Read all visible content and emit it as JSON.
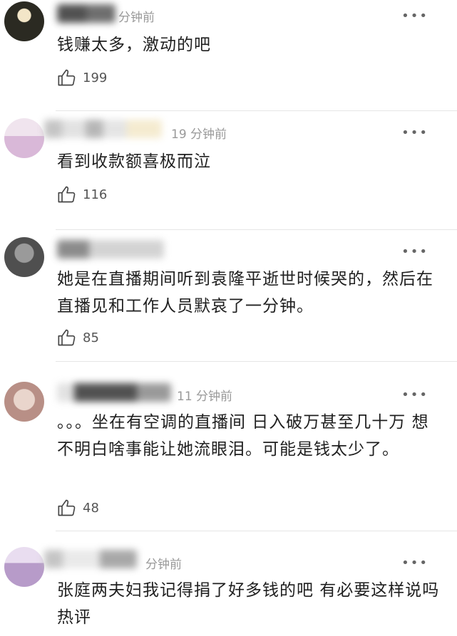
{
  "comments": [
    {
      "time": "分钟前",
      "text": "钱赚太多，激动的吧",
      "likes": "199",
      "more": "•••"
    },
    {
      "time": "19 分钟前",
      "text": "看到收款额喜极而泣",
      "likes": "116",
      "more": "•••"
    },
    {
      "time": "",
      "text": "她是在直播期间听到袁隆平逝世时候哭的，然后在直播见和工作人员默哀了一分钟。",
      "likes": "85",
      "more": "•••"
    },
    {
      "time": "11 分钟前",
      "text": "。。。坐在有空调的直播间 日入破万甚至几十万 想不明白啥事能让她流眼泪。可能是钱太少了。",
      "likes": "48",
      "more": "•••"
    },
    {
      "time": "分钟前",
      "text": "张庭两夫妇我记得捐了好多钱的吧 有必要这样说吗热评",
      "likes": "",
      "more": "•••"
    }
  ],
  "colors": {
    "avatar_1": "#3a3a2e",
    "avatar_2": "#d9b8d8",
    "avatar_3": "#6d6d6d",
    "avatar_4": "#c9a8a0",
    "avatar_5": "#b79bc9"
  },
  "icons": {
    "like": "thumbs-up-icon",
    "more": "more-dots-icon"
  }
}
